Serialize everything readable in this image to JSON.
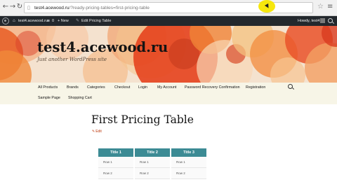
{
  "browser": {
    "url_host": "test4.acewood.ru",
    "url_path": "/?ready-pricing-tables=first-pricing-table"
  },
  "admin_bar": {
    "site_name": "test4.acewood.ru",
    "comments_count": "0",
    "new_label": "+ New",
    "edit_label": "Edit Pricing Table",
    "greeting": "Howdy, test4"
  },
  "header": {
    "site_title": "test4.acewood.ru",
    "tagline": "Just another WordPress site"
  },
  "nav": {
    "items": [
      "All Products",
      "Brands",
      "Categories",
      "Checkout",
      "Login",
      "My Account",
      "Password Recovery Confirmation",
      "Registration",
      "Sample Page",
      "Shopping Cart"
    ]
  },
  "content": {
    "page_title": "First Pricing Table",
    "edit_label": "Edit"
  },
  "pricing_tables": [
    {
      "title": "Title 1",
      "rows": [
        "Row 1",
        "Row 2"
      ]
    },
    {
      "title": "Title 2",
      "rows": [
        "Row 1",
        "Row 2"
      ]
    },
    {
      "title": "Title 3",
      "rows": [
        "Row 1",
        "Row 2"
      ]
    }
  ],
  "colors": {
    "admin_bar": "#23282d",
    "nav_bg": "#f7f5e7",
    "table_header": "#3c8b94",
    "edit_link": "#bc360a"
  }
}
